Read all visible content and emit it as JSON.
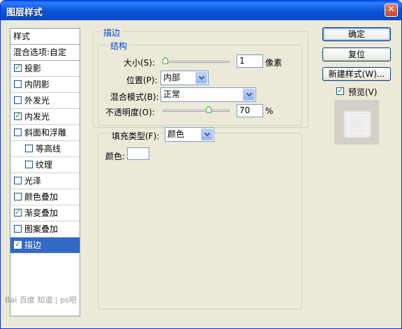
{
  "window": {
    "title": "图层样式",
    "close_icon": "close-icon"
  },
  "sidebar": {
    "header": "样式",
    "blend": "混合选项:自定",
    "items": [
      {
        "label": "投影",
        "checked": true,
        "indent": false,
        "selected": false
      },
      {
        "label": "内阴影",
        "checked": false,
        "indent": false,
        "selected": false
      },
      {
        "label": "外发光",
        "checked": false,
        "indent": false,
        "selected": false
      },
      {
        "label": "内发光",
        "checked": true,
        "indent": false,
        "selected": false
      },
      {
        "label": "斜面和浮雕",
        "checked": false,
        "indent": false,
        "selected": false
      },
      {
        "label": "等高线",
        "checked": false,
        "indent": true,
        "selected": false
      },
      {
        "label": "纹理",
        "checked": false,
        "indent": true,
        "selected": false
      },
      {
        "label": "光泽",
        "checked": false,
        "indent": false,
        "selected": false
      },
      {
        "label": "颜色叠加",
        "checked": false,
        "indent": false,
        "selected": false
      },
      {
        "label": "渐变叠加",
        "checked": true,
        "indent": false,
        "selected": false
      },
      {
        "label": "图案叠加",
        "checked": false,
        "indent": false,
        "selected": false
      },
      {
        "label": "描边",
        "checked": true,
        "indent": false,
        "selected": true
      }
    ]
  },
  "stroke": {
    "section_title": "描边",
    "structure_title": "结构",
    "size_label": "大小(S):",
    "size_value": "1",
    "size_unit": "像素",
    "size_level": 0.0,
    "position_label": "位置(P):",
    "position_value": "内部",
    "blend_label": "混合模式(B):",
    "blend_value": "正常",
    "opacity_label": "不透明度(O):",
    "opacity_value": "70",
    "opacity_unit": "%",
    "opacity_level": 0.7,
    "fill_type_label": "填充类型(F):",
    "fill_type_value": "颜色",
    "color_label": "颜色:",
    "color_value": "#FFFFFF"
  },
  "buttons": {
    "ok": "确定",
    "reset": "复位",
    "new_style": "新建样式(W)..."
  },
  "preview": {
    "label": "预览(V)",
    "checked": true
  },
  "watermark": "Bai 百度 知道 | ps吧"
}
